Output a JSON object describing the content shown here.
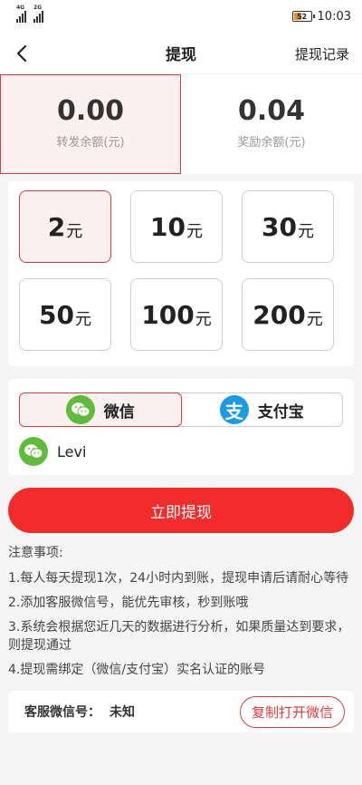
{
  "status_bar": {
    "network_1": "4G",
    "network_2": "2G",
    "battery": "52",
    "time": "10:03"
  },
  "nav": {
    "title": "提现",
    "right_link": "提现记录",
    "back_icon": "chevron-left-icon"
  },
  "balances": [
    {
      "value": "0.00",
      "label": "转发余额(元)",
      "selected": true
    },
    {
      "value": "0.04",
      "label": "奖励余额(元)",
      "selected": false
    }
  ],
  "amounts": [
    {
      "value": "2",
      "unit": "元",
      "selected": true
    },
    {
      "value": "10",
      "unit": "元",
      "selected": false
    },
    {
      "value": "30",
      "unit": "元",
      "selected": false
    },
    {
      "value": "50",
      "unit": "元",
      "selected": false
    },
    {
      "value": "100",
      "unit": "元",
      "selected": false
    },
    {
      "value": "200",
      "unit": "元",
      "selected": false
    }
  ],
  "payment": {
    "methods": [
      {
        "label": "微信",
        "icon": "wechat-icon",
        "selected": true
      },
      {
        "label": "支付宝",
        "icon": "alipay-icon",
        "selected": false
      }
    ],
    "account_name": "Levi"
  },
  "withdraw_button": "立即提现",
  "notes": {
    "title": "注意事项:",
    "items": [
      "1.每人每天提现1次，24小时内到账，提现申请后请耐心等待",
      "2.添加客服微信号，能优先审核，秒到账哦",
      "3.系统会根据您近几天的数据进行分析，如果质量达到要求，则提现通过",
      "4.提现需绑定（微信/支付宝）实名认证的账号"
    ]
  },
  "service": {
    "label": "客服微信号：",
    "value": "未知",
    "button": "复制打开微信"
  },
  "colors": {
    "accent": "#e23b3b",
    "button": "#f22b2b",
    "wechat": "#5fbb3a",
    "alipay": "#1a9be8"
  }
}
